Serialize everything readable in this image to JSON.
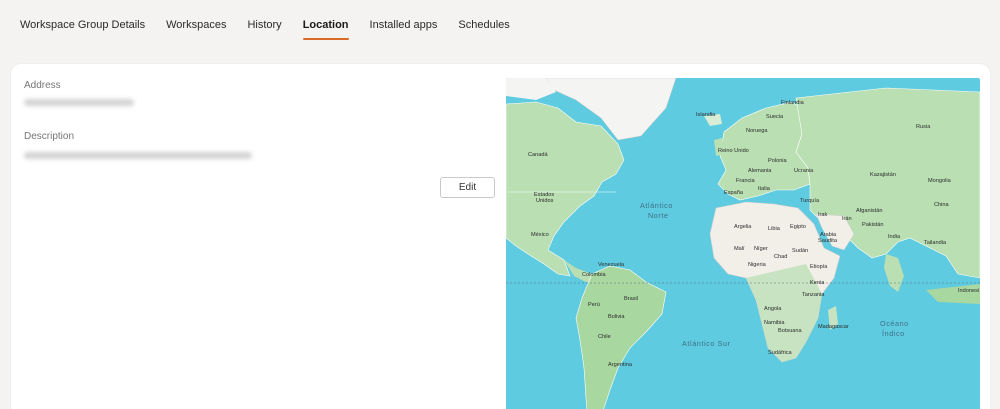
{
  "tabs": [
    {
      "label": "Workspace Group Details",
      "active": false
    },
    {
      "label": "Workspaces",
      "active": false
    },
    {
      "label": "History",
      "active": false
    },
    {
      "label": "Location",
      "active": true
    },
    {
      "label": "Installed apps",
      "active": false
    },
    {
      "label": "Schedules",
      "active": false
    }
  ],
  "details": {
    "address_label": "Address",
    "description_label": "Description",
    "edit_label": "Edit"
  },
  "map": {
    "countries": {
      "canada": "Canadá",
      "usa": "Estados\nUnidos",
      "mexico": "México",
      "venezuela": "Venezuela",
      "colombia": "Colombia",
      "peru": "Perú",
      "brasil": "Brasil",
      "bolivia": "Bolivia",
      "chile": "Chile",
      "argentina": "Argentina",
      "islandia": "Islandia",
      "finlandia": "Finlandia",
      "suecia": "Suecia",
      "noruega": "Noruega",
      "reino_unido": "Reino Unido",
      "polonia": "Polonia",
      "alemania": "Alemania",
      "ucrania": "Ucrania",
      "francia": "Francia",
      "espana": "España",
      "italia": "Italia",
      "rusia": "Rusia",
      "kazajistan": "Kazajistán",
      "mongolia": "Mongolia",
      "china": "China",
      "turquia": "Turquía",
      "irak": "Irak",
      "iran": "Irán",
      "afganistan": "Afganistán",
      "pakistan": "Pakistán",
      "india": "India",
      "tailandia": "Tailandia",
      "argelia": "Argelia",
      "libia": "Libia",
      "egipto": "Egipto",
      "arabia_saudita": "Arabia\nSaudita",
      "mali": "Malí",
      "niger": "Níger",
      "chad": "Chad",
      "sudan": "Sudán",
      "nigeria": "Nigeria",
      "etiopia": "Etiopía",
      "kenia": "Kenia",
      "tanzania": "Tanzania",
      "angola": "Angola",
      "namibia": "Namibia",
      "botsuana": "Botsuana",
      "madagascar": "Madagascar",
      "sudafrica": "Sudáfrica",
      "indonesia": "Indonesi"
    },
    "oceans": {
      "atlantico_norte": "Atlántico\nNorte",
      "atlantico_sur": "Atlántico Sur",
      "oceano_indico": "Océano\nÍndico"
    },
    "colors": {
      "water": "#5ecbe0",
      "land": "#c7e3c2",
      "land_dry": "#f2efe9",
      "forest": "#a8d7a0",
      "ice": "#f4f4f2"
    }
  }
}
